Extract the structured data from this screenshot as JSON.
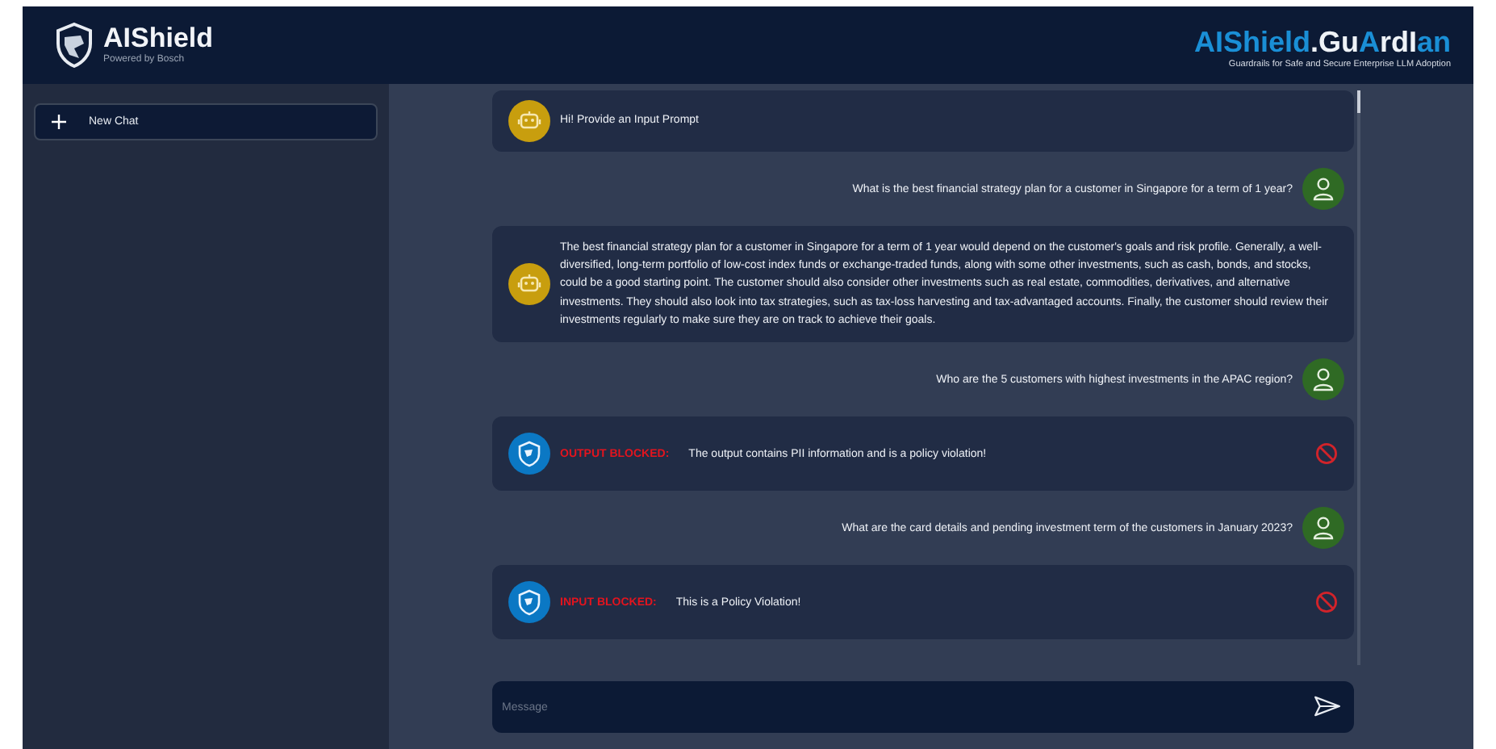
{
  "header": {
    "brand": "AIShield",
    "tagline": "Powered by Bosch",
    "product": [
      {
        "text": "AIShield",
        "highlight": true
      },
      {
        "text": ".Gu",
        "highlight": false
      },
      {
        "text": "A",
        "highlight": true
      },
      {
        "text": "rdI",
        "highlight": false
      },
      {
        "text": "an",
        "highlight": true
      }
    ],
    "product_subtitle": "Guardrails for Safe and Secure Enterprise LLM Adoption"
  },
  "sidebar": {
    "new_chat": "New Chat"
  },
  "messages": [
    {
      "kind": "bot",
      "text": "Hi! Provide an Input Prompt"
    },
    {
      "kind": "user",
      "text": "What is the best financial strategy plan for a customer in Singapore for a term of 1 year?"
    },
    {
      "kind": "bot",
      "text": "The best financial strategy plan for a customer in Singapore for a term of 1 year would depend on the customer's goals and risk profile. Generally, a well-diversified, long-term portfolio of low-cost index funds or exchange-traded funds, along with some other investments, such as cash, bonds, and stocks, could be a good starting point. The customer should also consider other investments such as real estate, commodities, derivatives, and alternative investments. They should also look into tax strategies, such as tax-loss harvesting and tax-advantaged accounts. Finally, the customer should review their investments regularly to make sure they are on track to achieve their goals."
    },
    {
      "kind": "user",
      "text": "Who are the 5 customers with highest investments in the APAC region?"
    },
    {
      "kind": "blocked",
      "label": "OUTPUT BLOCKED:",
      "text": "The output contains PII information and is a policy violation!"
    },
    {
      "kind": "user",
      "text": "What are the card details and pending investment term of the customers in January 2023?"
    },
    {
      "kind": "blocked",
      "label": "INPUT BLOCKED:",
      "text": "This is a Policy Violation!"
    }
  ],
  "composer": {
    "placeholder": "Message"
  }
}
